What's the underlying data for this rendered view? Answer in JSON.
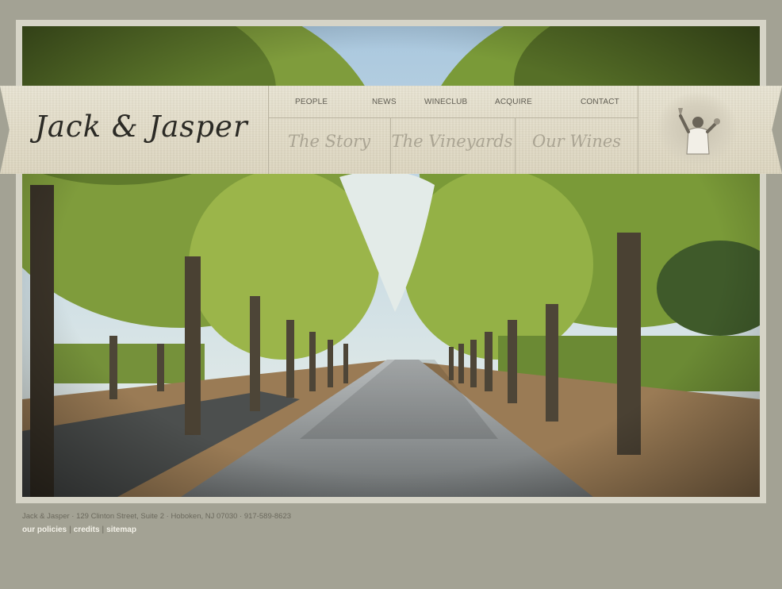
{
  "brand": {
    "logo": "Jack & Jasper"
  },
  "top_nav": [
    "PEOPLE",
    "NEWS",
    "WINECLUB",
    "ACQUIRE",
    "CONTACT"
  ],
  "sections": [
    "The Story",
    "The Vineyards",
    "Our Wines"
  ],
  "hero": {
    "image": "tree-lined vineyard road",
    "badge_image": "winemaker raising glass"
  },
  "footer": {
    "address": "Jack & Jasper · 129 Clinton Street, Suite 2 · Hoboken, NJ 07030 · 917-589-8623",
    "links": [
      "our policies",
      "credits",
      "sitemap"
    ],
    "separator": "|"
  },
  "colors": {
    "page_bg": "#a3a294",
    "banner": "#e4dfcc",
    "link": "#f3f1e8"
  }
}
